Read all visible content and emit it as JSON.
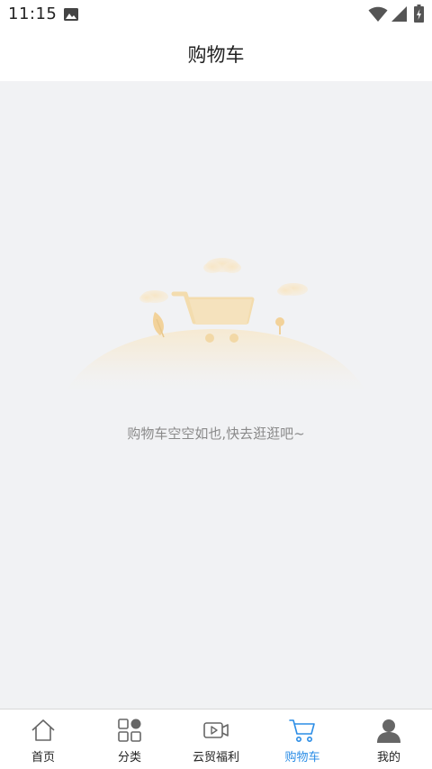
{
  "status_bar": {
    "time": "11:15",
    "icons": [
      "image-icon",
      "wifi-icon",
      "cellular-signal-icon",
      "battery-charging-icon"
    ]
  },
  "header": {
    "title": "购物车"
  },
  "empty_state": {
    "illustration": "empty-shopping-cart-illustration",
    "message": "购物车空空如也,快去逛逛吧~"
  },
  "tab_bar": {
    "active_tab": "购物车",
    "accent_color": "#2b8de6",
    "tabs": [
      {
        "label": "首页",
        "icon": "home-icon"
      },
      {
        "label": "分类",
        "icon": "category-icon"
      },
      {
        "label": "云贸福利",
        "icon": "video-icon"
      },
      {
        "label": "购物车",
        "icon": "cart-icon"
      },
      {
        "label": "我的",
        "icon": "user-icon"
      }
    ]
  }
}
